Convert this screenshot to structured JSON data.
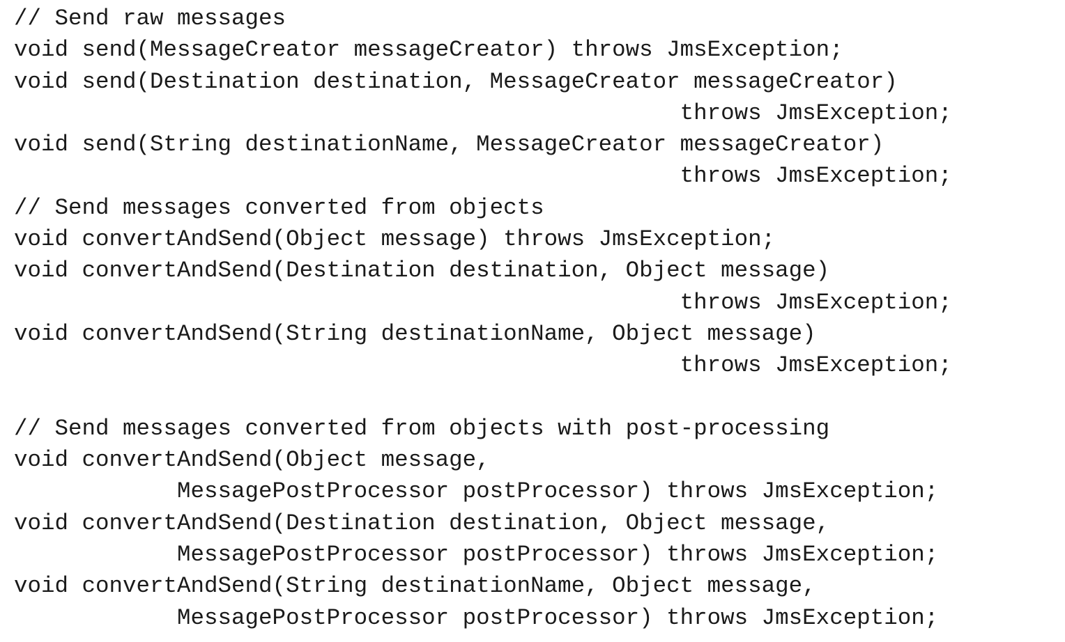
{
  "code_lines": [
    "// Send raw messages",
    "void send(MessageCreator messageCreator) throws JmsException;",
    "void send(Destination destination, MessageCreator messageCreator)",
    "                                                 throws JmsException;",
    "void send(String destinationName, MessageCreator messageCreator)",
    "                                                 throws JmsException;",
    "// Send messages converted from objects",
    "void convertAndSend(Object message) throws JmsException;",
    "void convertAndSend(Destination destination, Object message)",
    "                                                 throws JmsException;",
    "void convertAndSend(String destinationName, Object message)",
    "                                                 throws JmsException;",
    "",
    "// Send messages converted from objects with post-processing",
    "void convertAndSend(Object message,",
    "            MessagePostProcessor postProcessor) throws JmsException;",
    "void convertAndSend(Destination destination, Object message,",
    "            MessagePostProcessor postProcessor) throws JmsException;",
    "void convertAndSend(String destinationName, Object message,",
    "            MessagePostProcessor postProcessor) throws JmsException;"
  ]
}
